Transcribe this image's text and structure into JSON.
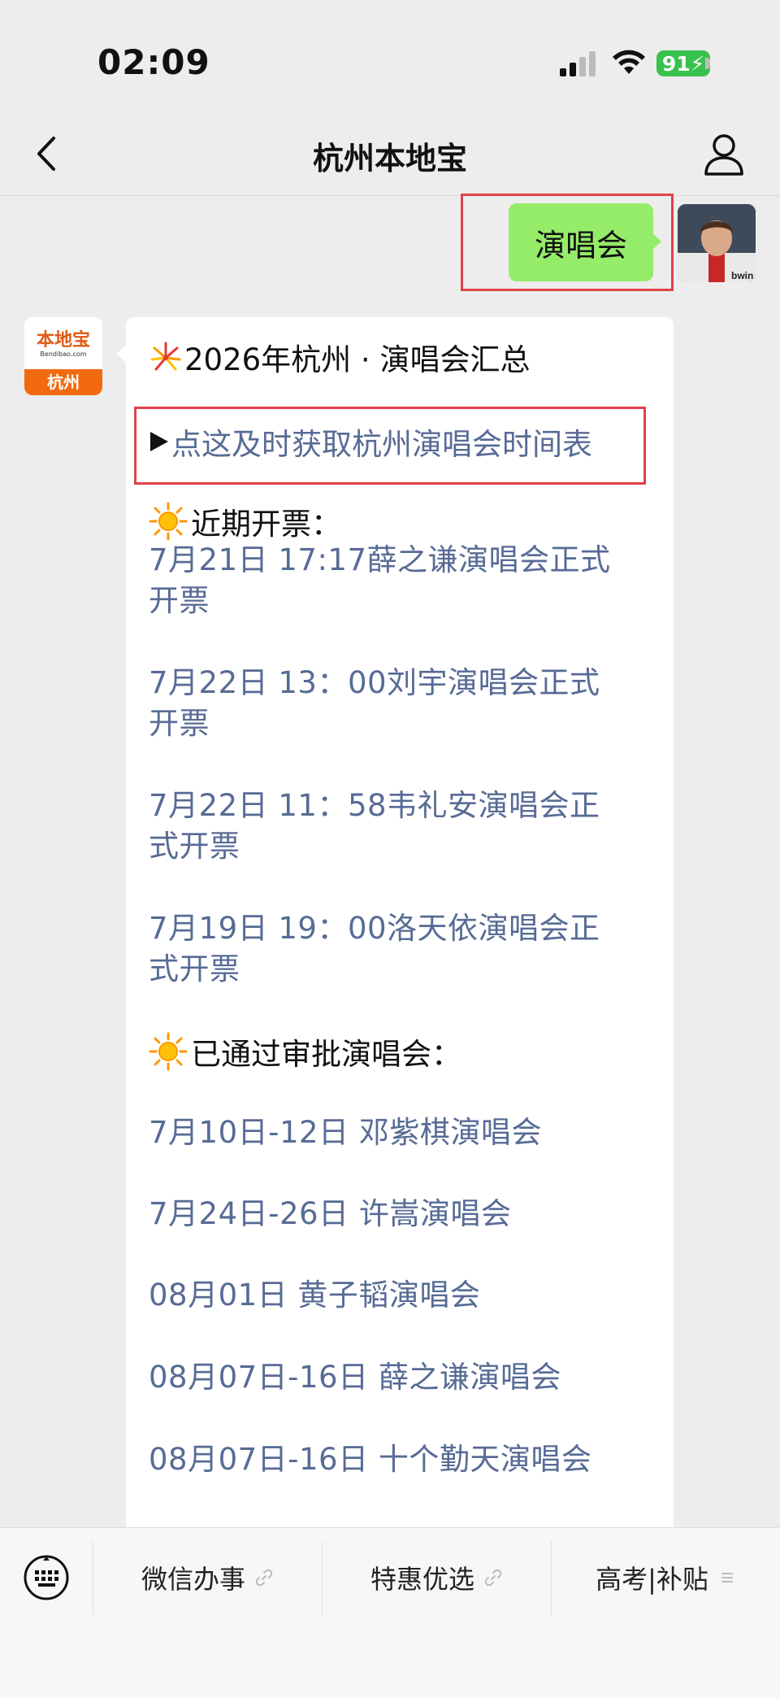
{
  "status_bar": {
    "time": "02:09",
    "battery": "91"
  },
  "nav": {
    "title": "杭州本地宝"
  },
  "outgoing": {
    "text": "演唱会"
  },
  "bot": {
    "avatar_text": "本地宝",
    "avatar_sub": "Bendibao.com",
    "avatar_city": "杭州"
  },
  "message": {
    "title": "2026年杭州 · 演唱会汇总",
    "link": "点这及时获取杭州演唱会时间表",
    "section1": "近期开票：",
    "recent": [
      {
        "line1": "7月21日 17:17薛之谦演唱会正式",
        "line2": "开票"
      },
      {
        "line1": "7月22日 13：00刘宇演唱会正式",
        "line2": "开票"
      },
      {
        "line1": "7月22日 11：58韦礼安演唱会正",
        "line2": "式开票"
      },
      {
        "line1": "7月19日 19：00洛天依演唱会正",
        "line2": "式开票"
      }
    ],
    "section2": "已通过审批演唱会：",
    "approved": [
      "7月10日-12日 邓紫棋演唱会",
      "7月24日-26日 许嵩演唱会",
      "08月01日 黄子韬演唱会",
      "08月07日-16日 薛之谦演唱会",
      "08月07日-16日 十个勤天演唱会"
    ]
  },
  "menu": {
    "items": [
      {
        "label": "微信办事",
        "icon": "link-icon"
      },
      {
        "label": "特惠优选",
        "icon": "link-icon"
      },
      {
        "label": "高考|补贴",
        "icon": "menu-list-icon"
      }
    ]
  },
  "colors": {
    "link": "#576b95",
    "outgoing_bubble": "#95ec69",
    "highlight": "#e0414a"
  }
}
